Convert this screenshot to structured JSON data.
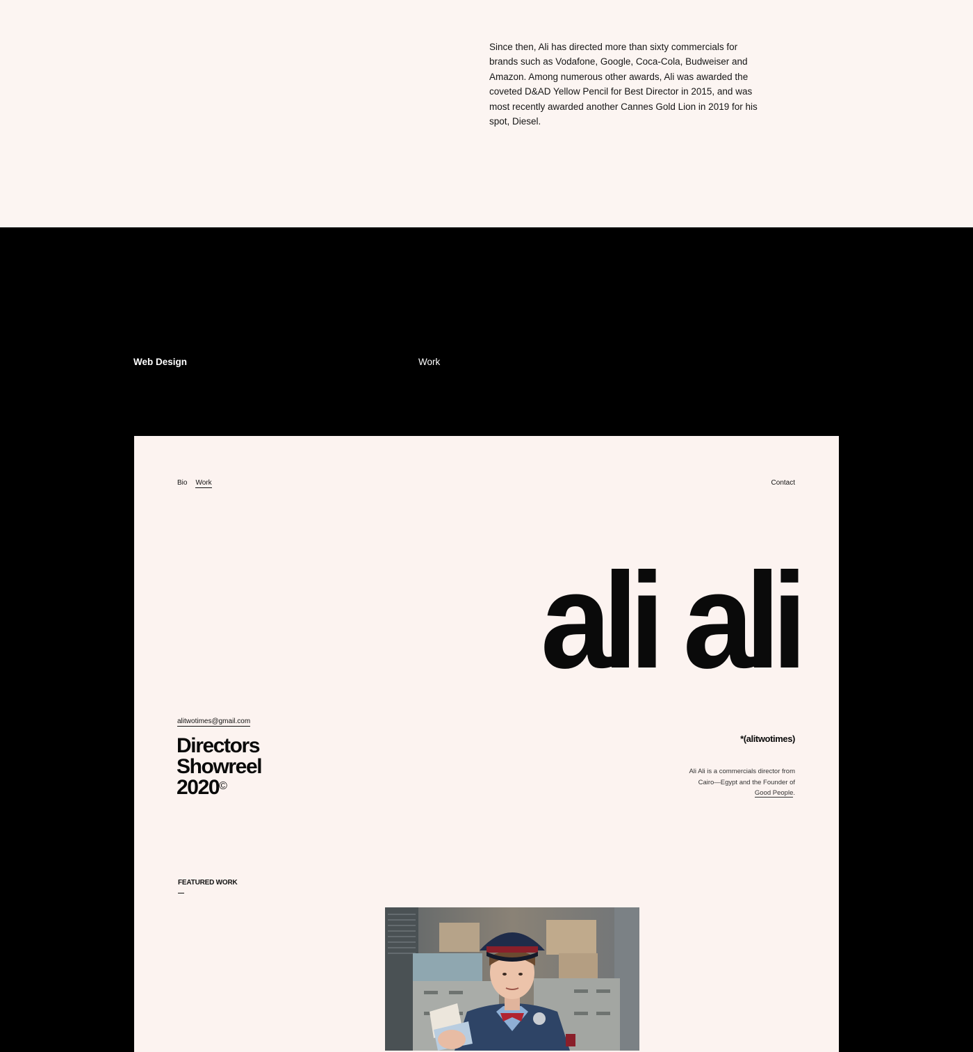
{
  "bio_section": {
    "paragraph": "Since then, Ali has directed more than sixty commercials for brands such as Vodafone, Google, Coca-Cola, Budweiser and Amazon. Among numerous other awards, Ali was awarded the coveted D&AD Yellow Pencil for Best Director in 2015, and was most recently awarded another Cannes Gold Lion in 2019 for his spot, Diesel."
  },
  "project_header": {
    "category": "Web Design",
    "type": "Work"
  },
  "mock_site": {
    "nav": {
      "bio": "Bio",
      "work": "Work",
      "contact": "Contact"
    },
    "hero_name": "ali ali",
    "email": "alitwotimes@gmail.com",
    "showreel": {
      "line1": "Directors",
      "line2": "Showreel",
      "year": "2020",
      "copyright_mark": "©"
    },
    "handle": "*(alitwotimes)",
    "short_bio": {
      "text": "Ali Ali is a commercials director from Cairo—Egypt and the Founder of ",
      "link": "Good People",
      "end": "."
    },
    "featured_label": "FEATURED WORK",
    "video_thumbnail_icon": "video-still-icon"
  },
  "colors": {
    "cream_background": "#fcf5f2",
    "mock_background": "#fcf3f0",
    "dark_background": "#000000",
    "text_dark": "#0a0a0a",
    "text_light": "#ffffff"
  }
}
